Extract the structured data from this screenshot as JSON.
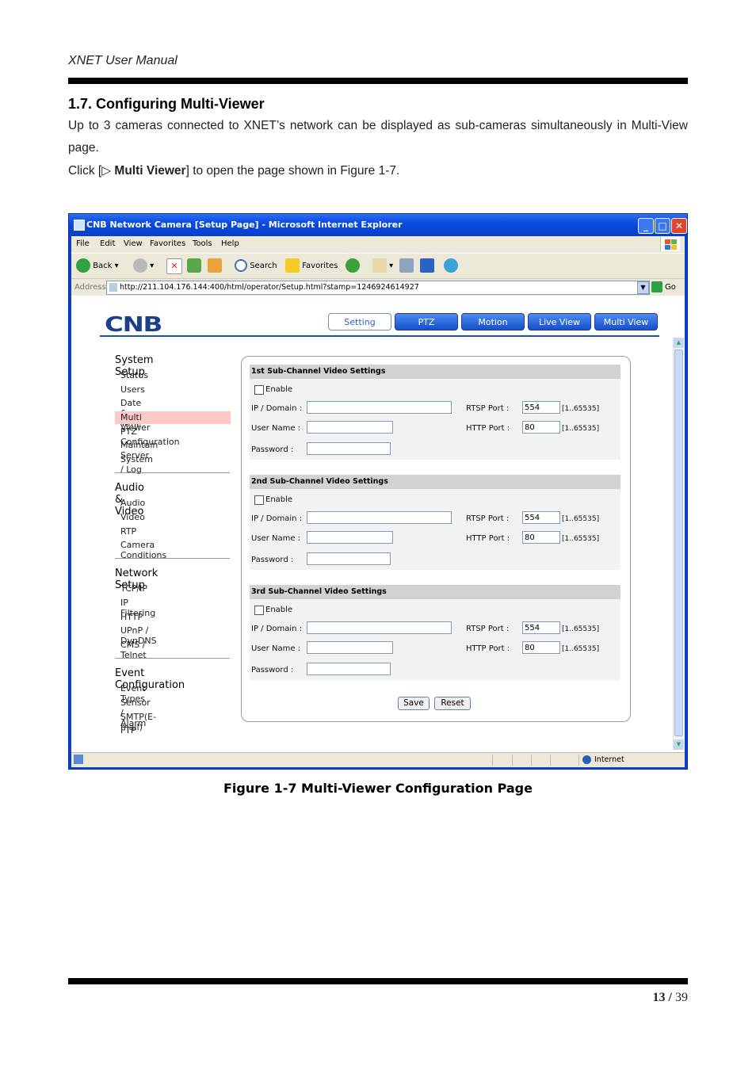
{
  "doc": {
    "header": "XNET User Manual",
    "section_title": "1.7. Configuring Multi-Viewer",
    "para1": "Up to 3 cameras connected to XNET’s network can be displayed as sub-cameras simultaneously in Multi-View page.",
    "para2_prefix": "Click [▷ ",
    "para2_bold": "Multi Viewer",
    "para2_suffix": "] to open the page shown in Figure 1-7.",
    "caption": "Figure 1-7 Multi-Viewer Configuration Page",
    "page_current": "13 /",
    "page_total": " 39"
  },
  "browser": {
    "title": "CNB Network Camera [Setup Page] - Microsoft Internet Explorer",
    "menu": [
      "File",
      "Edit",
      "View",
      "Favorites",
      "Tools",
      "Help"
    ],
    "toolbar": {
      "back": "Back",
      "search": "Search",
      "favorites": "Favorites"
    },
    "address_label": "Address",
    "url": "http://211.104.176.144:400/html/operator/Setup.html?stamp=1246924614927",
    "go": "Go",
    "status_zone": "Internet"
  },
  "app": {
    "logo": "CNB",
    "nav": [
      "Setting",
      "PTZ",
      "Motion",
      "Live View",
      "Multi View"
    ],
    "sidebar": {
      "system_setup": "System Setup",
      "system_items": [
        "Status",
        "Users",
        "Date & Time",
        "Multi Viewer",
        "PTZ Configuration",
        "Maintain Server",
        "System / Log"
      ],
      "audio_video": "Audio & Video",
      "av_items": [
        "Audio",
        "Video",
        "RTP",
        "Camera Conditions"
      ],
      "network_setup": "Network Setup",
      "net_items": [
        "TCP/IP",
        "IP Filtering",
        "HTTP",
        "UPnP / DynDNS",
        "CMS / Telnet"
      ],
      "event_config": "Event Configuration",
      "event_items": [
        "Event Types",
        "Sensor / Alarm",
        "SMTP(E-mail)",
        "FTP"
      ]
    },
    "sections": [
      {
        "title": "1st Sub-Channel Video Settings",
        "enable": "Enable",
        "ip_label": "IP / Domain :",
        "user_label": "User Name :",
        "pass_label": "Password :",
        "rtsp_label": "RTSP Port :",
        "rtsp_value": "554",
        "http_label": "HTTP Port :",
        "http_value": "80",
        "range": "[1..65535]"
      },
      {
        "title": "2nd Sub-Channel Video Settings",
        "enable": "Enable",
        "ip_label": "IP / Domain :",
        "user_label": "User Name :",
        "pass_label": "Password :",
        "rtsp_label": "RTSP Port :",
        "rtsp_value": "554",
        "http_label": "HTTP Port :",
        "http_value": "80",
        "range": "[1..65535]"
      },
      {
        "title": "3rd Sub-Channel Video Settings",
        "enable": "Enable",
        "ip_label": "IP / Domain :",
        "user_label": "User Name :",
        "pass_label": "Password :",
        "rtsp_label": "RTSP Port :",
        "rtsp_value": "554",
        "http_label": "HTTP Port :",
        "http_value": "80",
        "range": "[1..65535]"
      }
    ],
    "save": "Save",
    "reset": "Reset"
  }
}
